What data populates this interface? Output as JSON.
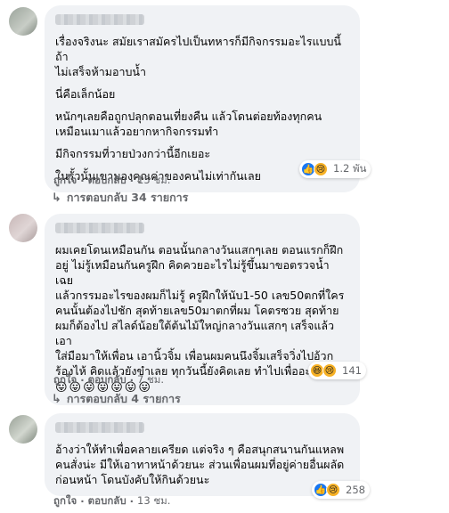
{
  "comments": [
    {
      "paragraphs": [
        "เรื่องจริงนะ สมัยเราสมัครไปเป็นทหารก็มีกิจกรรมอะไรแบบนี้ ถ้า\nไม่เสร็จห้ามอาบน้ำ",
        "นี่คือเล็กน้อย",
        "หนักๆเลยคือถูกปลุกตอนเที่ยงคืน แล้วโดนต่อยท้องทุกคน\nเหมือนเมาแล้วอยากหากิจกรรมทำ",
        "มีกิจกรรมที่วายป่วงกว่านี้อีกเยอะ",
        "ในรั้วนั้นเขามองคุณค่าของคนไม่เท่ากันเลย"
      ],
      "reactions": {
        "icons": [
          "like-icon",
          "sad-icon"
        ],
        "count": "1.2 พัน"
      },
      "like_label": "ถูกใจ",
      "reply_label": "ตอบกลับ",
      "time": "15 ชม.",
      "replies_label": "การตอบกลับ 34 รายการ"
    },
    {
      "paragraphs": [
        "ผมเคยโดนเหมือนกัน ตอนนั้นกลางวันแสกๆเลย ตอนแรกก็ฝึก\nอยู่ ไม่รู้เหมือนกันครูฝึก คิดควยอะไรไม่รู้ขึ้นมาขอตรวจน้ำ เฉย\nแล้วกรรมอะไรของผมก็ไม่รู้ ครูฝึกให้นับ1-50 เลข50ตกที่ใคร\nคนนั้นต้องไปชัก สุดท้ายเลข50มาตกที่ผม โคตรซวย สุดท้าย\nผมก็ต้องไป สไลด์น้อยใต้ต้นไม้ใหญ่กลางวันแสกๆ เสร็จแล้วเอา\nใส่มือมาให้เพื่อน เอานิ้วจิ้ม เพื่อนผมคนนึงจิ้มเสร็จวิ่งไปอ้วก\nร้องไห้ คิดแล้วยังขำเลย ทุกวันนี้ยังคิดเลย ทำไปเพื่ออะไร 😛"
      ],
      "emoji_row": "😛😛😛😛😛😛😛",
      "reactions": {
        "icons": [
          "haha-icon",
          "sad-icon"
        ],
        "count": "141"
      },
      "like_label": "ถูกใจ",
      "reply_label": "ตอบกลับ",
      "time": "7 ชม.",
      "replies_label": "การตอบกลับ 4 รายการ"
    },
    {
      "paragraphs": [
        "อ้างว่าให้ทำเพื่อคลายเครียด แต่จริง ๆ คือสนุกสนานกันแหลพ\nคนสั่งน่ะ มีให้เอาทาหน้าด้วยนะ ส่วนเพื่อนผมที่อยู่ค่ายอื่นผลัด\nก่อนหน้า โดนบังคับให้กินด้วยนะ"
      ],
      "reactions": {
        "icons": [
          "like-icon",
          "sad-icon"
        ],
        "count": "258"
      },
      "like_label": "ถูกใจ",
      "reply_label": "ตอบกลับ",
      "time": "13 ชม."
    }
  ],
  "colors": {
    "bubble": "#f0f2f5",
    "meta": "#65676b",
    "like": "#1877f2",
    "sad": "#f7b125"
  }
}
